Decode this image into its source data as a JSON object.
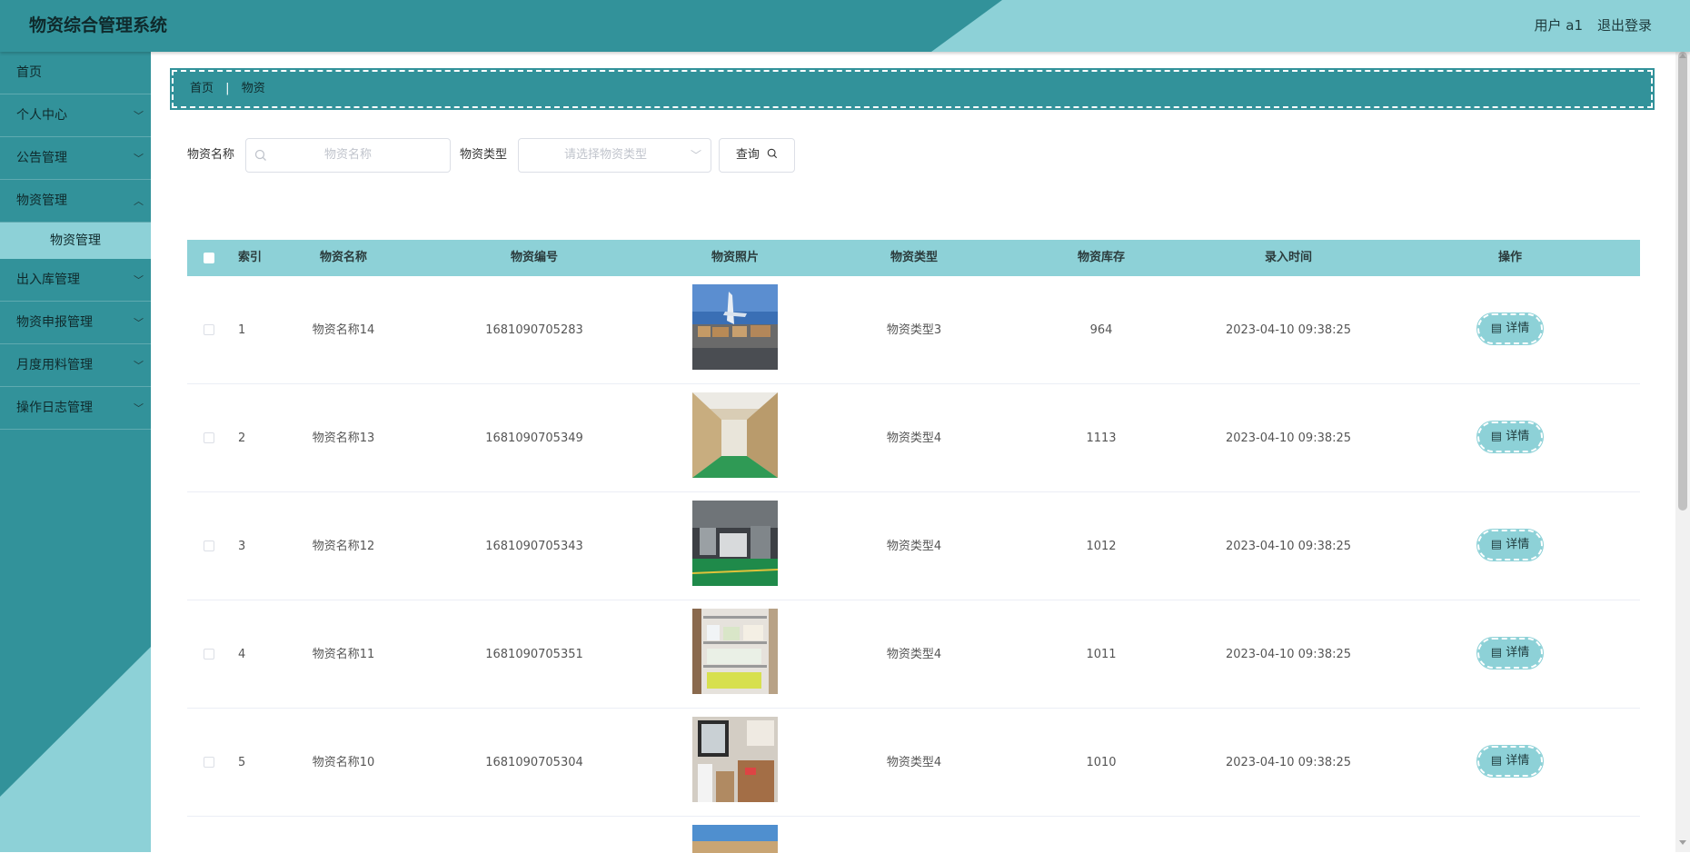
{
  "header": {
    "title": "物资综合管理系统",
    "user_label": "用户 a1",
    "logout_label": "退出登录"
  },
  "sidebar": {
    "items": [
      {
        "label": "首页"
      },
      {
        "label": "个人中心"
      },
      {
        "label": "公告管理"
      },
      {
        "label": "物资管理"
      },
      {
        "label": "物资管理"
      },
      {
        "label": "出入库管理"
      },
      {
        "label": "物资申报管理"
      },
      {
        "label": "月度用料管理"
      },
      {
        "label": "操作日志管理"
      }
    ]
  },
  "breadcrumb": {
    "home": "首页",
    "separator": "|",
    "current": "物资"
  },
  "filters": {
    "name_label": "物资名称",
    "name_placeholder": "物资名称",
    "type_label": "物资类型",
    "type_placeholder": "请选择物资类型",
    "query_label": "查询"
  },
  "table": {
    "columns": [
      "索引",
      "物资名称",
      "物资编号",
      "物资照片",
      "物资类型",
      "物资库存",
      "录入时间",
      "操作"
    ],
    "detail_label": "详情",
    "rows": [
      {
        "index": "1",
        "name": "物资名称14",
        "code": "1681090705283",
        "type": "物资类型3",
        "stock": "964",
        "time": "2023-04-10 09:38:25"
      },
      {
        "index": "2",
        "name": "物资名称13",
        "code": "1681090705349",
        "type": "物资类型4",
        "stock": "1113",
        "time": "2023-04-10 09:38:25"
      },
      {
        "index": "3",
        "name": "物资名称12",
        "code": "1681090705343",
        "type": "物资类型4",
        "stock": "1012",
        "time": "2023-04-10 09:38:25"
      },
      {
        "index": "4",
        "name": "物资名称11",
        "code": "1681090705351",
        "type": "物资类型4",
        "stock": "1011",
        "time": "2023-04-10 09:38:25"
      },
      {
        "index": "5",
        "name": "物资名称10",
        "code": "1681090705304",
        "type": "物资类型4",
        "stock": "1010",
        "time": "2023-04-10 09:38:25"
      }
    ]
  },
  "colors": {
    "primary": "#32929a",
    "light": "#8dd1d7"
  }
}
